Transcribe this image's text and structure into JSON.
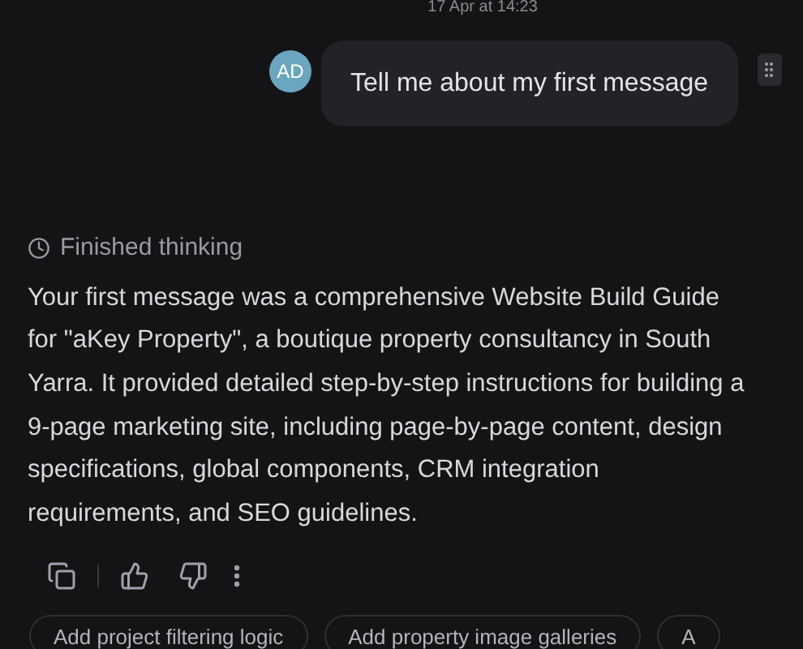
{
  "timestamp": "17 Apr at 14:23",
  "user_message": {
    "avatar": "AD",
    "text": "Tell me about my first message"
  },
  "thinking": {
    "label": "Finished thinking"
  },
  "response": "Your first message was a comprehensive Website Build Guide for \"aKey Property\", a boutique property consultancy in South Yarra. It provided detailed step-by-step instructions for building a 9-page marketing site, including page-by-page content, design specifications, global components, CRM integration requirements, and SEO guidelines.",
  "suggestions": [
    "Add project filtering logic",
    "Add property image galleries",
    "A"
  ]
}
